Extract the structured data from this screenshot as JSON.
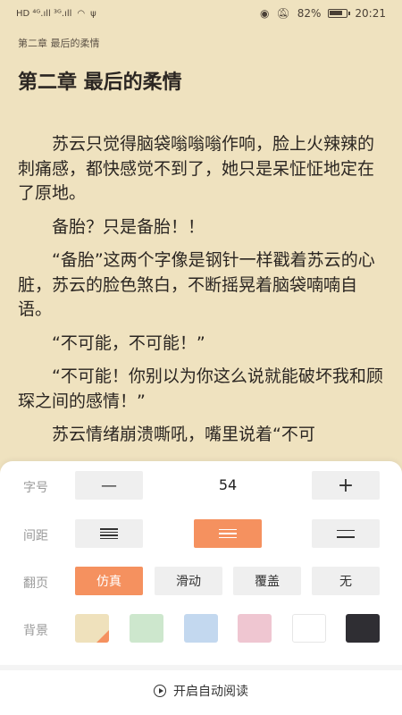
{
  "status_bar": {
    "network_left": "HD ⁴ᴳ.ıll ³ᴳ.ıll",
    "battery_percent": "82%",
    "time": "20:21"
  },
  "reader": {
    "chapter_header": "第二章 最后的柔情",
    "chapter_title": "第二章 最后的柔情",
    "paragraphs": [
      "苏云只觉得脑袋嗡嗡嗡作响，脸上火辣辣的刺痛感，都快感觉不到了，她只是呆怔怔地定在了原地。",
      "备胎？只是备胎！！",
      "“备胎”这两个字像是钢针一样戳着苏云的心脏，苏云的脸色煞白，不断摇晃着脑袋喃喃自语。",
      "“不可能，不可能！”",
      "“不可能！你别以为你这么说就能破坏我和顾琛之间的感情！”",
      "苏云情绪崩溃嘶吼，嘴里说着“不可"
    ]
  },
  "settings": {
    "font_size": {
      "label": "字号",
      "decrease": "—",
      "value": "54",
      "increase": "+"
    },
    "spacing": {
      "label": "间距",
      "options": [
        "tight",
        "medium",
        "wide"
      ],
      "selected": "medium"
    },
    "page_turn": {
      "label": "翻页",
      "options": [
        "仿真",
        "滑动",
        "覆盖",
        "无"
      ],
      "selected": "仿真"
    },
    "background": {
      "label": "背景",
      "colors": [
        "#efe1bc",
        "#cde7cd",
        "#c3d8ef",
        "#efc6d1",
        "#ffffff",
        "#2f2e33"
      ],
      "selected_index": 0
    },
    "auto_read": "开启自动阅读"
  },
  "colors": {
    "accent": "#f5915f",
    "page_bg": "#efe2bf"
  }
}
